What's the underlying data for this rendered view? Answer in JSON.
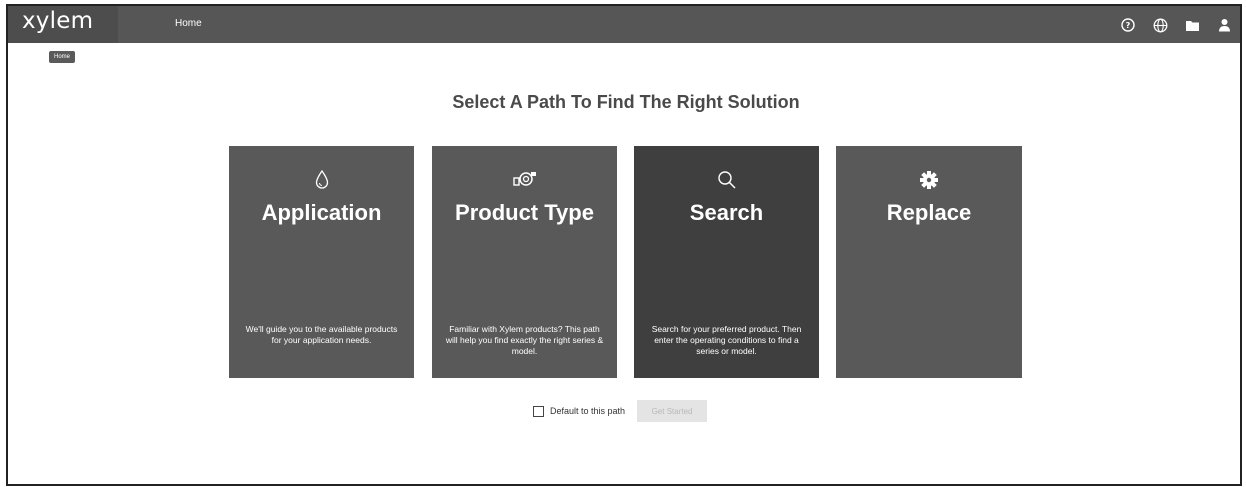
{
  "header": {
    "logo": "xylem",
    "nav_home": "Home",
    "icons": [
      "help-icon",
      "globe-icon",
      "folder-icon",
      "user-icon"
    ]
  },
  "tooltip": "Home",
  "main": {
    "title": "Select A Path To Find The Right Solution",
    "cards": [
      {
        "title": "Application",
        "icon": "water-drop-icon",
        "desc": "We'll guide you to the available products for your application needs."
      },
      {
        "title": "Product Type",
        "icon": "pump-icon",
        "desc": "Familiar with Xylem products? This path will help you find exactly the right series & model."
      },
      {
        "title": "Search",
        "icon": "search-icon",
        "desc": "Search for your preferred product. Then enter the operating conditions to find a series or model."
      },
      {
        "title": "Replace",
        "icon": "gear-icon",
        "desc": ""
      }
    ],
    "default_label": "Default to this path",
    "get_started_label": "Get Started"
  },
  "colors": {
    "topbar": "#565656",
    "card": "#595959",
    "card_selected": "#3f3f3f"
  }
}
